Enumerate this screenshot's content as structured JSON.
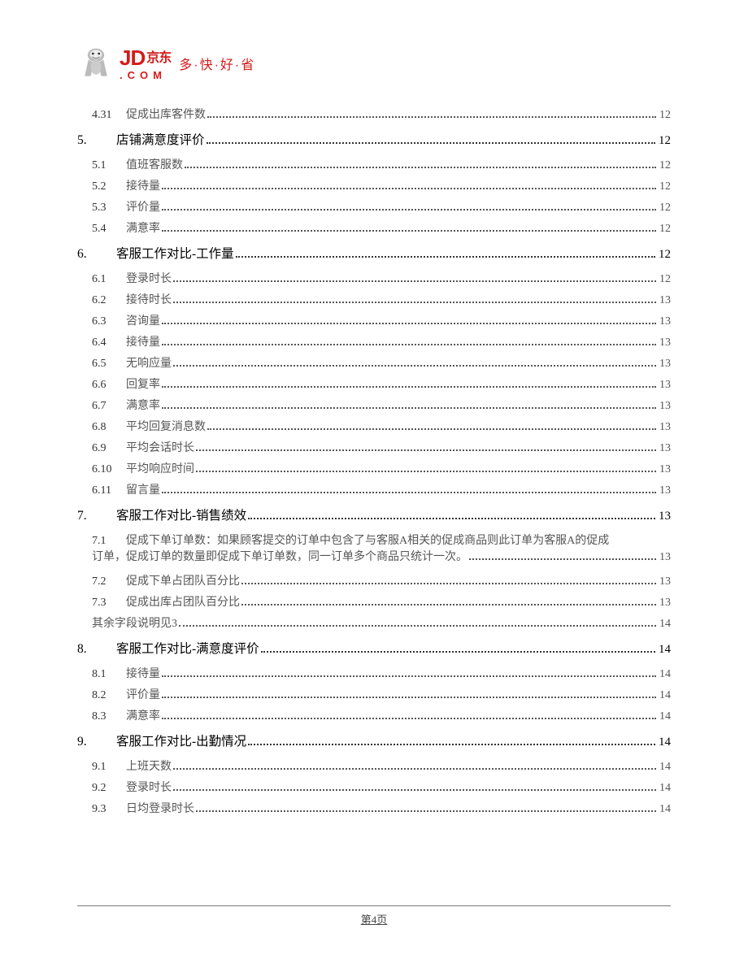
{
  "logo": {
    "jd": "JD",
    "cn": "京东",
    "dotcom": ".COM",
    "slogan": "多·快·好·省"
  },
  "toc": [
    {
      "level": 2,
      "num": "4.31",
      "title": "促成出库客件数",
      "page": "12"
    },
    {
      "level": 1,
      "num": "5.",
      "title": "店铺满意度评价",
      "page": "12"
    },
    {
      "level": 2,
      "num": "5.1",
      "title": "值班客服数",
      "page": "12"
    },
    {
      "level": 2,
      "num": "5.2",
      "title": "接待量",
      "page": "12"
    },
    {
      "level": 2,
      "num": "5.3",
      "title": "评价量",
      "page": "12"
    },
    {
      "level": 2,
      "num": "5.4",
      "title": "满意率",
      "page": "12"
    },
    {
      "level": 1,
      "num": "6.",
      "title": "客服工作对比-工作量",
      "page": "12"
    },
    {
      "level": 2,
      "num": "6.1",
      "title": "登录时长",
      "page": "12"
    },
    {
      "level": 2,
      "num": "6.2",
      "title": "接待时长",
      "page": "13"
    },
    {
      "level": 2,
      "num": "6.3",
      "title": "咨询量",
      "page": "13"
    },
    {
      "level": 2,
      "num": "6.4",
      "title": "接待量",
      "page": "13"
    },
    {
      "level": 2,
      "num": "6.5",
      "title": "无响应量",
      "page": "13"
    },
    {
      "level": 2,
      "num": "6.6",
      "title": "回复率",
      "page": "13"
    },
    {
      "level": 2,
      "num": "6.7",
      "title": "满意率",
      "page": "13"
    },
    {
      "level": 2,
      "num": "6.8",
      "title": "平均回复消息数",
      "page": "13"
    },
    {
      "level": 2,
      "num": "6.9",
      "title": "平均会话时长",
      "page": "13"
    },
    {
      "level": 2,
      "num": "6.10",
      "title": "平均响应时间",
      "page": "13"
    },
    {
      "level": 2,
      "num": "6.11",
      "title": "留言量",
      "page": "13"
    },
    {
      "level": 1,
      "num": "7.",
      "title": "客服工作对比-销售绩效",
      "page": "13"
    },
    {
      "level": 3,
      "num": "7.1",
      "line1": "促成下单订单数：如果顾客提交的订单中包含了与客服A相关的促成商品则此订单为客服A的促成",
      "line2": "订单，促成订单的数量即促成下单订单数，同一订单多个商品只统计一次。",
      "page": "13"
    },
    {
      "level": 2,
      "num": "7.2",
      "title": "促成下单占团队百分比",
      "page": "13"
    },
    {
      "level": 2,
      "num": "7.3",
      "title": "促成出库占团队百分比",
      "page": "13"
    },
    {
      "level": 4,
      "num": "",
      "title": "其余字段说明见3",
      "page": "14"
    },
    {
      "level": 1,
      "num": "8.",
      "title": "客服工作对比-满意度评价",
      "page": "14"
    },
    {
      "level": 2,
      "num": "8.1",
      "title": "接待量",
      "page": "14"
    },
    {
      "level": 2,
      "num": "8.2",
      "title": "评价量",
      "page": "14"
    },
    {
      "level": 2,
      "num": "8.3",
      "title": "满意率",
      "page": "14"
    },
    {
      "level": 1,
      "num": "9.",
      "title": "客服工作对比-出勤情况",
      "page": "14"
    },
    {
      "level": 2,
      "num": "9.1",
      "title": "上班天数",
      "page": "14"
    },
    {
      "level": 2,
      "num": "9.2",
      "title": "登录时长",
      "page": "14"
    },
    {
      "level": 2,
      "num": "9.3",
      "title": "日均登录时长",
      "page": "14"
    }
  ],
  "footer": "第4页"
}
